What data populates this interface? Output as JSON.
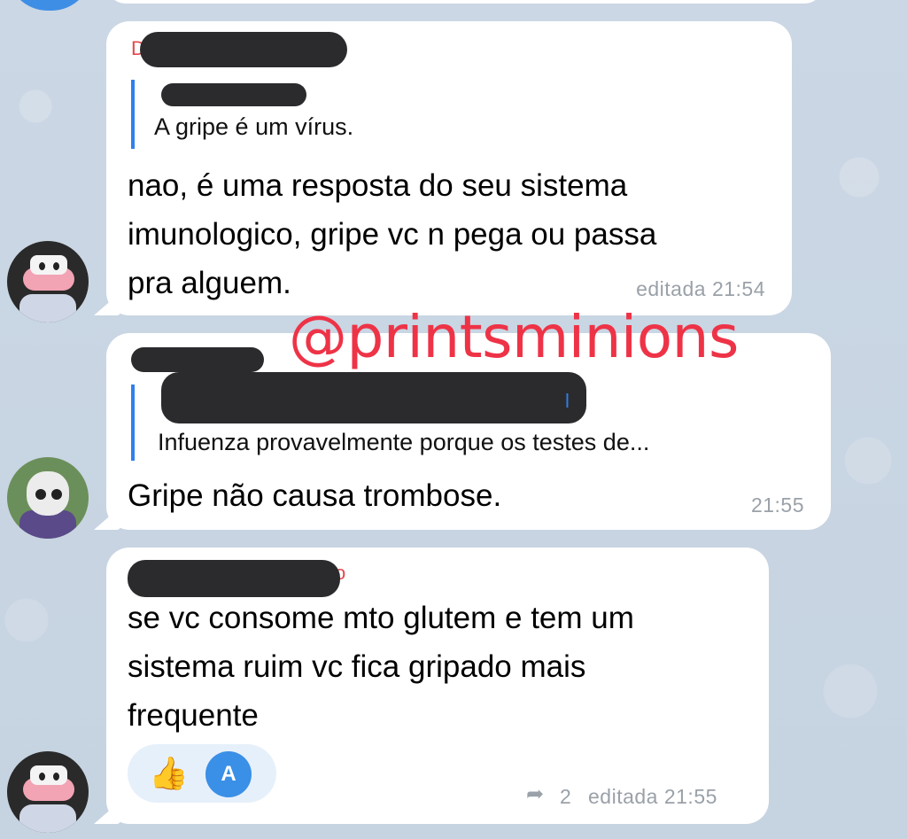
{
  "watermark": "@printsminions",
  "messages": [
    {
      "sender_fragment": "D",
      "quote": {
        "text": "A gripe é um vírus."
      },
      "lines": [
        "nao, é uma resposta do seu sistema",
        "imunologico, gripe vc n pega ou passa",
        "pra alguem."
      ],
      "meta": "editada 21:54"
    },
    {
      "quote": {
        "name_fragment": "l",
        "text": "Infuenza provavelmente porque os testes de..."
      },
      "lines": [
        "Gripe não causa trombose."
      ],
      "meta": "21:55"
    },
    {
      "sender_fragment": "o",
      "lines": [
        "se vc consome mto glutem e tem um",
        "sistema ruim vc fica gripado mais",
        "frequente"
      ],
      "reactions": {
        "emoji": "👍",
        "avatar_letter": "A"
      },
      "reply_count": "2",
      "meta": "editada 21:55"
    }
  ],
  "colors": {
    "accent": "#2f80ed",
    "watermark": "#ee3347",
    "meta": "#9aa1a8",
    "background": "#c9d6e3",
    "bubble": "#ffffff",
    "redaction": "#2b2b2e"
  }
}
